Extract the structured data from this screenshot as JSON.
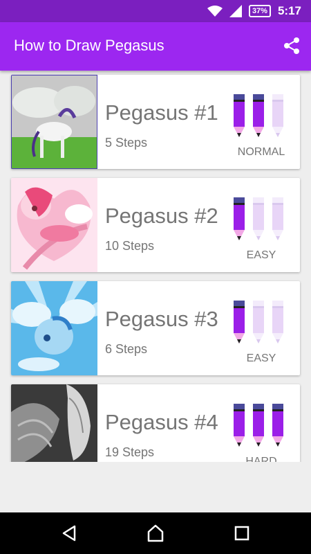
{
  "status": {
    "battery": "37%",
    "time": "5:17"
  },
  "appbar": {
    "title": "How to Draw Pegasus"
  },
  "cards": [
    {
      "title": "Pegasus #1",
      "steps": "5 Steps",
      "difficulty": "NORMAL",
      "level": 2
    },
    {
      "title": "Pegasus #2",
      "steps": "10 Steps",
      "difficulty": "EASY",
      "level": 1
    },
    {
      "title": "Pegasus #3",
      "steps": "6 Steps",
      "difficulty": "EASY",
      "level": 1
    },
    {
      "title": "Pegasus #4",
      "steps": "19 Steps",
      "difficulty": "HARD",
      "level": 3
    }
  ],
  "colors": {
    "statusbar": "#7b1fbf",
    "appbar": "#9c27f0",
    "pencil_full": "#9b1fe8",
    "pencil_empty": "#e8d5f7"
  }
}
